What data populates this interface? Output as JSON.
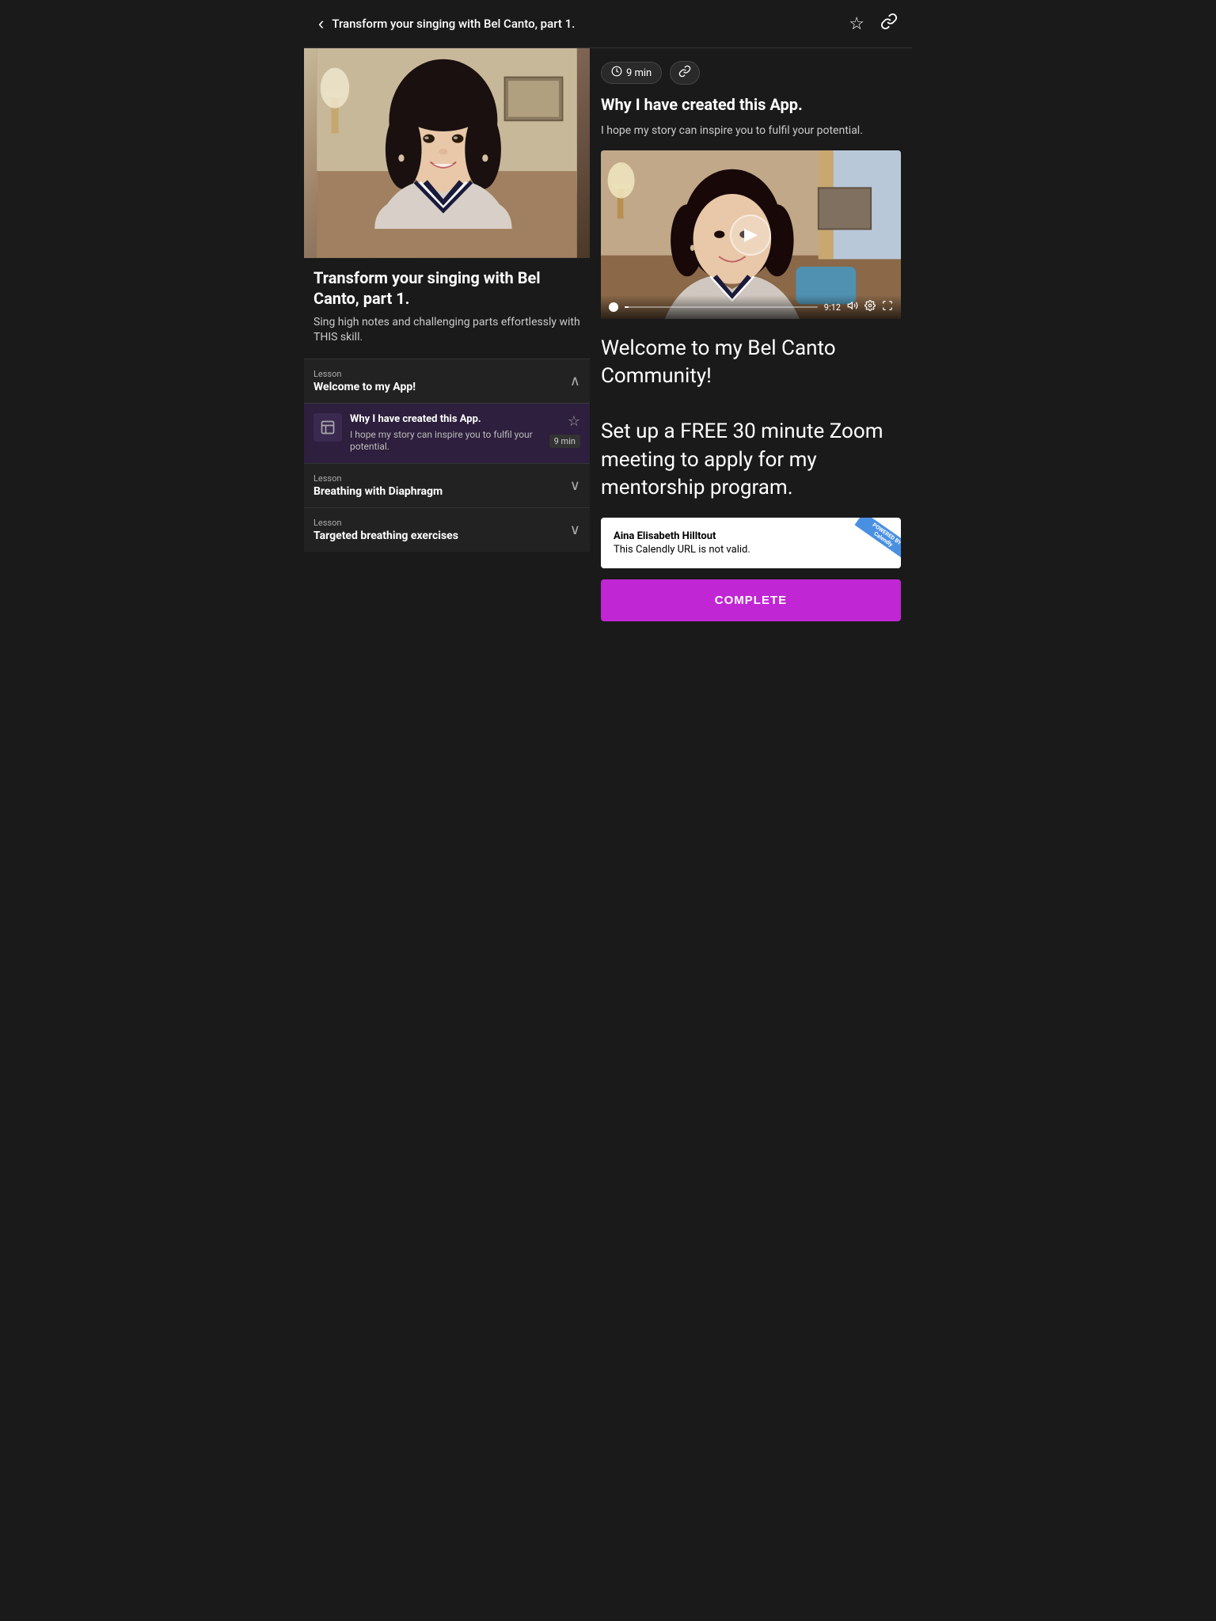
{
  "header": {
    "back_label": "‹",
    "title": "Transform your singing with Bel Canto, part 1.",
    "bookmark_icon": "☆",
    "link_icon": "🔗"
  },
  "course": {
    "title": "Transform your singing with Bel Canto, part 1.",
    "subtitle": "Sing high notes and challenging parts effortlessly with THIS skill."
  },
  "lesson_sections": [
    {
      "label": "Lesson",
      "name": "Welcome to my App!",
      "expanded": true,
      "items": [
        {
          "title": "Why I have created this App.",
          "description": "I hope my story can inspire you to fulfil your potential.",
          "duration": "9 min",
          "icon": "📖"
        }
      ]
    },
    {
      "label": "Lesson",
      "name": "Breathing with Diaphragm",
      "expanded": false,
      "items": []
    },
    {
      "label": "Lesson",
      "name": "Targeted breathing exercises",
      "expanded": false,
      "items": []
    }
  ],
  "detail": {
    "duration": "9 min",
    "duration_icon": "⏱",
    "link_icon": "🔗",
    "title": "Why I have created this App.",
    "description": "I hope my story can inspire you to fulfil your potential.",
    "video": {
      "time": "9:12",
      "sound_icon": "🔊",
      "settings_icon": "⚙",
      "fullscreen_icon": "⛶"
    },
    "content_text": "Welcome to my Bel Canto Community!\n\nSet up a FREE 30 minute Zoom meeting to apply for my mentorship program.",
    "calendly": {
      "name": "Aina Elisabeth Hilltout",
      "error": "This Calendly URL is not valid.",
      "powered": "POWERED BY",
      "brand": "Calendly"
    },
    "complete_button": "COMPLETE"
  }
}
